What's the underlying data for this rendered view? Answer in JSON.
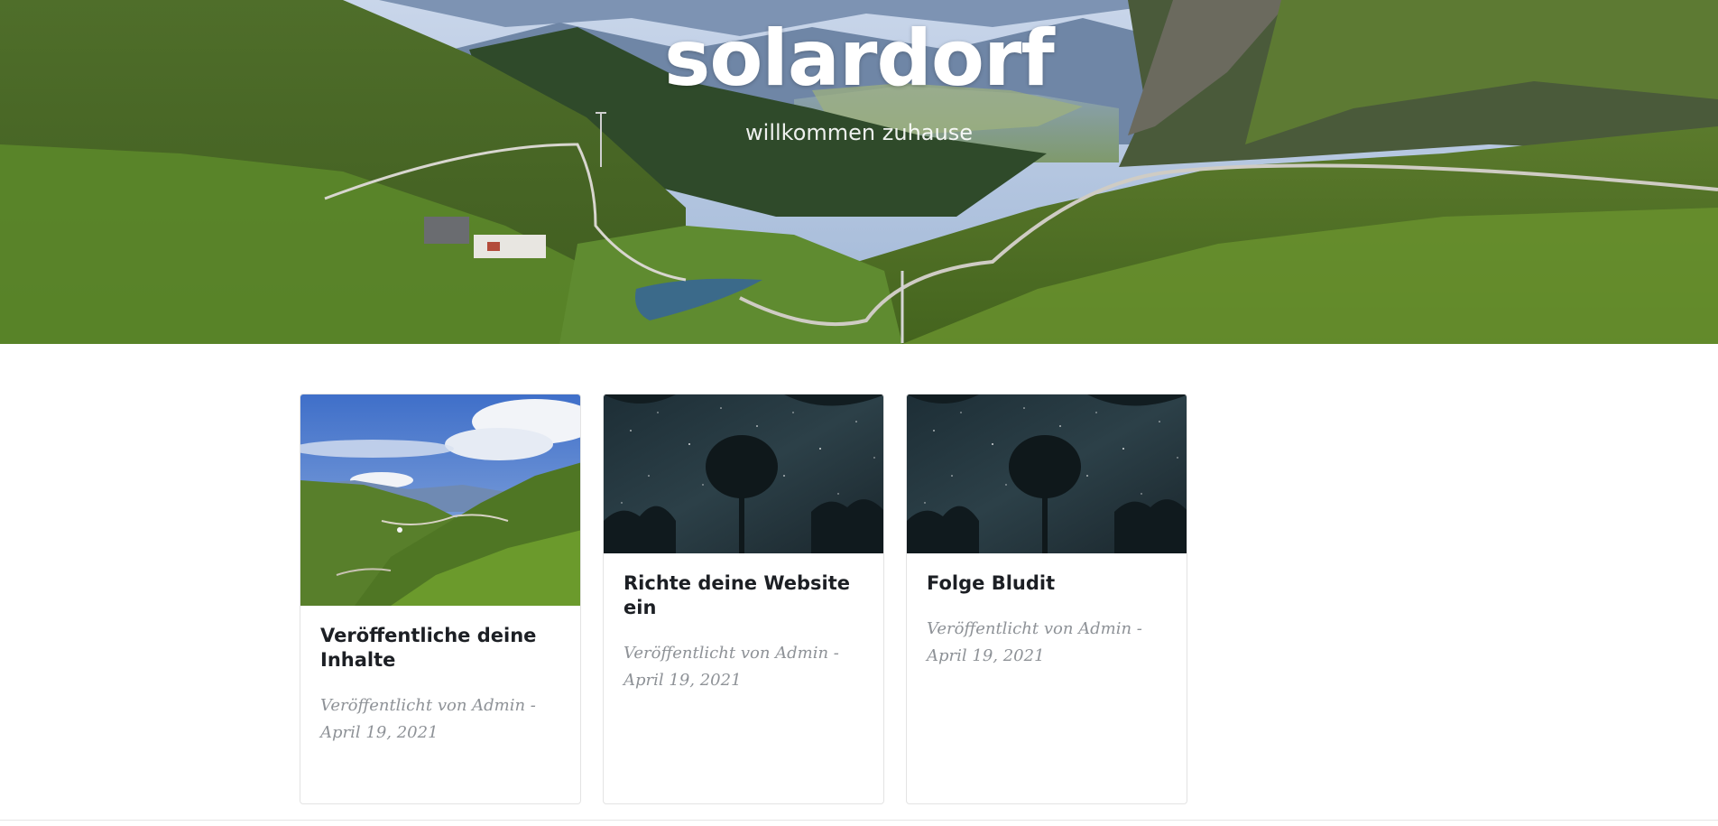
{
  "site": {
    "title": "solardorf",
    "subtitle": "willkommen zuhause"
  },
  "posts": [
    {
      "title": "Veröffentliche deine Inhalte",
      "meta_line1": "Veröffentlicht von Admin -",
      "meta_line2": "April 19, 2021",
      "image": "alpine-valley-photo"
    },
    {
      "title": "Richte deine Website ein",
      "meta_line1": "Veröffentlicht von Admin -",
      "meta_line2": "April 19, 2021",
      "image": "starry-sky-tree-photo"
    },
    {
      "title": "Folge Bludit",
      "meta_line1": "Veröffentlicht von Admin -",
      "meta_line2": "April 19, 2021",
      "image": "starry-sky-tree-photo"
    }
  ]
}
